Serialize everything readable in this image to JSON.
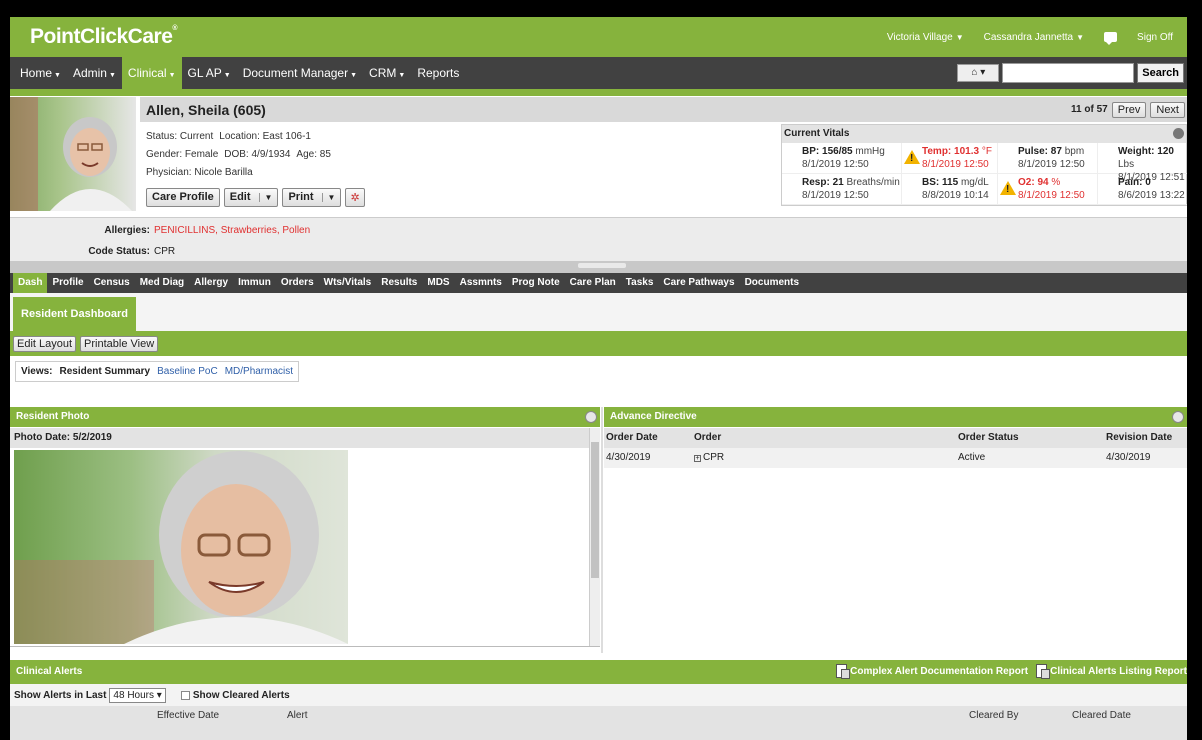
{
  "brand": {
    "logo": "PointClickCare",
    "facility": "Victoria Village",
    "user": "Cassandra Jannetta",
    "signoff": "Sign Off"
  },
  "nav": {
    "items": [
      {
        "label": "Home",
        "dropdown": true
      },
      {
        "label": "Admin",
        "dropdown": true
      },
      {
        "label": "Clinical",
        "dropdown": true,
        "active": true
      },
      {
        "label": "GL AP",
        "dropdown": true
      },
      {
        "label": "Document Manager",
        "dropdown": true
      },
      {
        "label": "CRM",
        "dropdown": true
      },
      {
        "label": "Reports",
        "dropdown": false
      }
    ],
    "search_value": "",
    "search_label": "Search",
    "home_icon": "home-icon"
  },
  "resident": {
    "name": "Allen, Sheila (605)",
    "status": "Status: Current",
    "location": "Location: East 106-1",
    "gender": "Gender: Female",
    "dob": "DOB: 4/9/1934",
    "age": "Age: 85",
    "physician": "Physician: Nicole Barilla",
    "buttons": {
      "care_profile": "Care Profile",
      "edit": "Edit",
      "print": "Print"
    },
    "pager": {
      "position": "11 of 57",
      "prev": "Prev",
      "next": "Next"
    }
  },
  "vitals": {
    "title": "Current Vitals",
    "rows": [
      [
        {
          "name": "BP:",
          "value": "156/85",
          "unit": "mmHg",
          "date": "8/1/2019 12:50",
          "alert": false
        },
        {
          "name": "Temp:",
          "value": "101.3",
          "unit": "°F",
          "date": "8/1/2019 12:50",
          "alert": true
        },
        {
          "name": "Pulse:",
          "value": "87",
          "unit": "bpm",
          "date": "8/1/2019 12:50",
          "alert": false
        },
        {
          "name": "Weight:",
          "value": "120",
          "unit": "Lbs",
          "date": "8/1/2019 12:51",
          "alert": false
        }
      ],
      [
        {
          "name": "Resp:",
          "value": "21",
          "unit": "Breaths/min",
          "date": "8/1/2019 12:50",
          "alert": false
        },
        {
          "name": "BS:",
          "value": "115",
          "unit": "mg/dL",
          "date": "8/8/2019 10:14",
          "alert": false
        },
        {
          "name": "O2:",
          "value": "94",
          "unit": "%",
          "date": "8/1/2019 12:50",
          "alert": true
        },
        {
          "name": "Pain:",
          "value": "0",
          "unit": "",
          "date": "8/6/2019 13:22",
          "alert": false
        }
      ]
    ]
  },
  "allergies": {
    "label": "Allergies:",
    "value": "PENICILLINS, Strawberries, Pollen",
    "code_label": "Code Status:",
    "code_value": "CPR"
  },
  "tabs": [
    "Dash",
    "Profile",
    "Census",
    "Med Diag",
    "Allergy",
    "Immun",
    "Orders",
    "Wts/Vitals",
    "Results",
    "MDS",
    "Assmnts",
    "Prog Note",
    "Care Plan",
    "Tasks",
    "Care Pathways",
    "Documents"
  ],
  "subtab": "Resident Dashboard",
  "layout_buttons": {
    "edit": "Edit Layout",
    "print": "Printable View"
  },
  "views": {
    "label": "Views:",
    "current": "Resident Summary",
    "links": [
      "Baseline PoC",
      "MD/Pharmacist"
    ]
  },
  "photo_panel": {
    "title": "Resident Photo",
    "photo_date": "Photo Date: 5/2/2019"
  },
  "advance_directive": {
    "title": "Advance Directive",
    "columns": [
      "Order Date",
      "Order",
      "Order Status",
      "Revision Date"
    ],
    "rows": [
      [
        "4/30/2019",
        "CPR",
        "Active",
        "4/30/2019"
      ]
    ]
  },
  "clinical_alerts": {
    "title": "Clinical Alerts",
    "report1": "Complex Alert Documentation Report",
    "report2": "Clinical Alerts Listing Report",
    "show_label": "Show Alerts in Last",
    "range": "48 Hours",
    "show_cleared": "Show Cleared Alerts",
    "columns": [
      "Effective Date",
      "Alert",
      "Cleared By",
      "Cleared Date"
    ]
  }
}
